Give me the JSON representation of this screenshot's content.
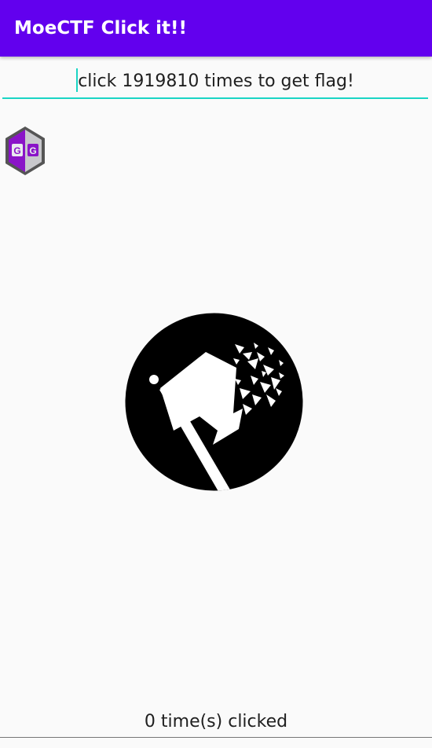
{
  "app_bar": {
    "title": "MoeCTF Click it!!"
  },
  "input": {
    "value": "click 1919810 times to get flag!"
  },
  "floating_icon": {
    "letters": [
      "G",
      "G"
    ]
  },
  "flag_button": {
    "icon": "flag-icon"
  },
  "counter": {
    "text": "0 time(s) clicked"
  },
  "colors": {
    "app_bar": "#6200ee",
    "accent": "#1ad5c4",
    "background": "#fafafa",
    "gg_purple": "#8a14c8",
    "gg_gray": "#c8c8cc"
  }
}
